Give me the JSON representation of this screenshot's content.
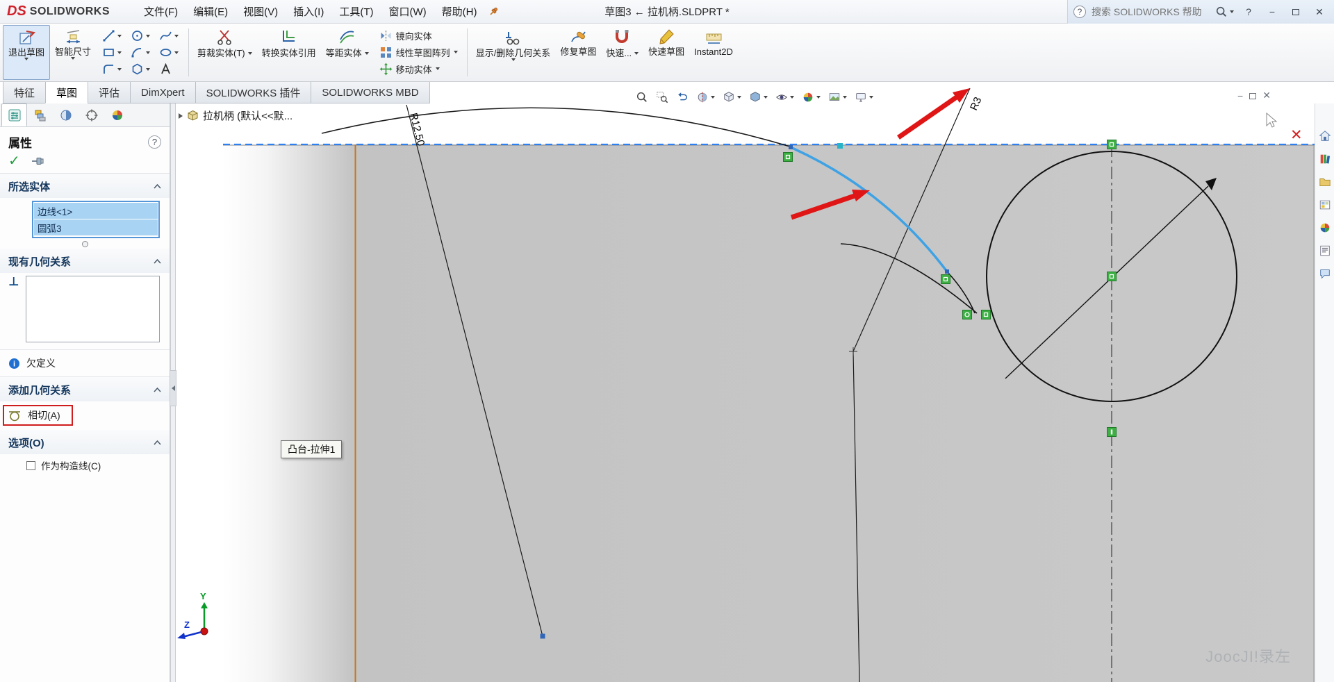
{
  "titlebar": {
    "logo_badge": "DS",
    "logo_text": "SOLIDWORKS",
    "menus": [
      {
        "label": "文件(F)"
      },
      {
        "label": "编辑(E)"
      },
      {
        "label": "视图(V)"
      },
      {
        "label": "插入(I)"
      },
      {
        "label": "工具(T)"
      },
      {
        "label": "窗口(W)"
      },
      {
        "label": "帮助(H)"
      }
    ],
    "document_title": "草图3 ← 拉机柄.SLDPRT *",
    "search_placeholder": "搜索 SOLIDWORKS 帮助"
  },
  "command_bar": {
    "exit_sketch": "退出草图",
    "smart_dimension": "智能尺寸",
    "trim_entities": "剪裁实体(T)",
    "convert_entities": "转换实体引用",
    "offset_entities": "等距实体",
    "mirror_entities": "镜向实体",
    "linear_pattern": "线性草图阵列",
    "move_entities": "移动实体",
    "display_delete_relations": "显示/删除几何关系",
    "repair_sketch": "修复草图",
    "quick_snaps": "快速...",
    "rapid_sketch": "快速草图",
    "instant2d": "Instant2D"
  },
  "tabs": [
    {
      "label": "特征"
    },
    {
      "label": "草图"
    },
    {
      "label": "评估"
    },
    {
      "label": "DimXpert"
    },
    {
      "label": "SOLIDWORKS 插件"
    },
    {
      "label": "SOLIDWORKS MBD"
    }
  ],
  "property_manager": {
    "title": "属性",
    "sections": {
      "selected_entities": {
        "header": "所选实体",
        "items": [
          {
            "label": "边线<1>"
          },
          {
            "label": "圆弧3"
          }
        ]
      },
      "existing_relations": {
        "header": "现有几何关系"
      },
      "status": "欠定义",
      "add_relations": {
        "header": "添加几何关系",
        "tangent_label": "相切(A)"
      },
      "options": {
        "header": "选项(O)",
        "construction_label": "作为构造线(C)"
      }
    }
  },
  "graphics": {
    "breadcrumb": "拉机柄 (默认<<默...",
    "tooltip": "凸台-拉伸1",
    "dimensions": {
      "radius_large": "R12.50",
      "radius_small": "R3"
    },
    "triad": {
      "y_label": "Y",
      "z_label": "Z"
    },
    "watermark": "JoocJI!录左"
  },
  "glyphs": {
    "help": "?",
    "check": "✓",
    "minimize": "−",
    "close": "✕",
    "perpendicular": "⊥",
    "info": "i",
    "delete_x": "✕"
  },
  "colors": {
    "selection_blue": "#3ea2e5",
    "relation_green": "#3cb043",
    "annotation_red": "#e01616",
    "edge_highlight_orange": "#c8761c"
  }
}
